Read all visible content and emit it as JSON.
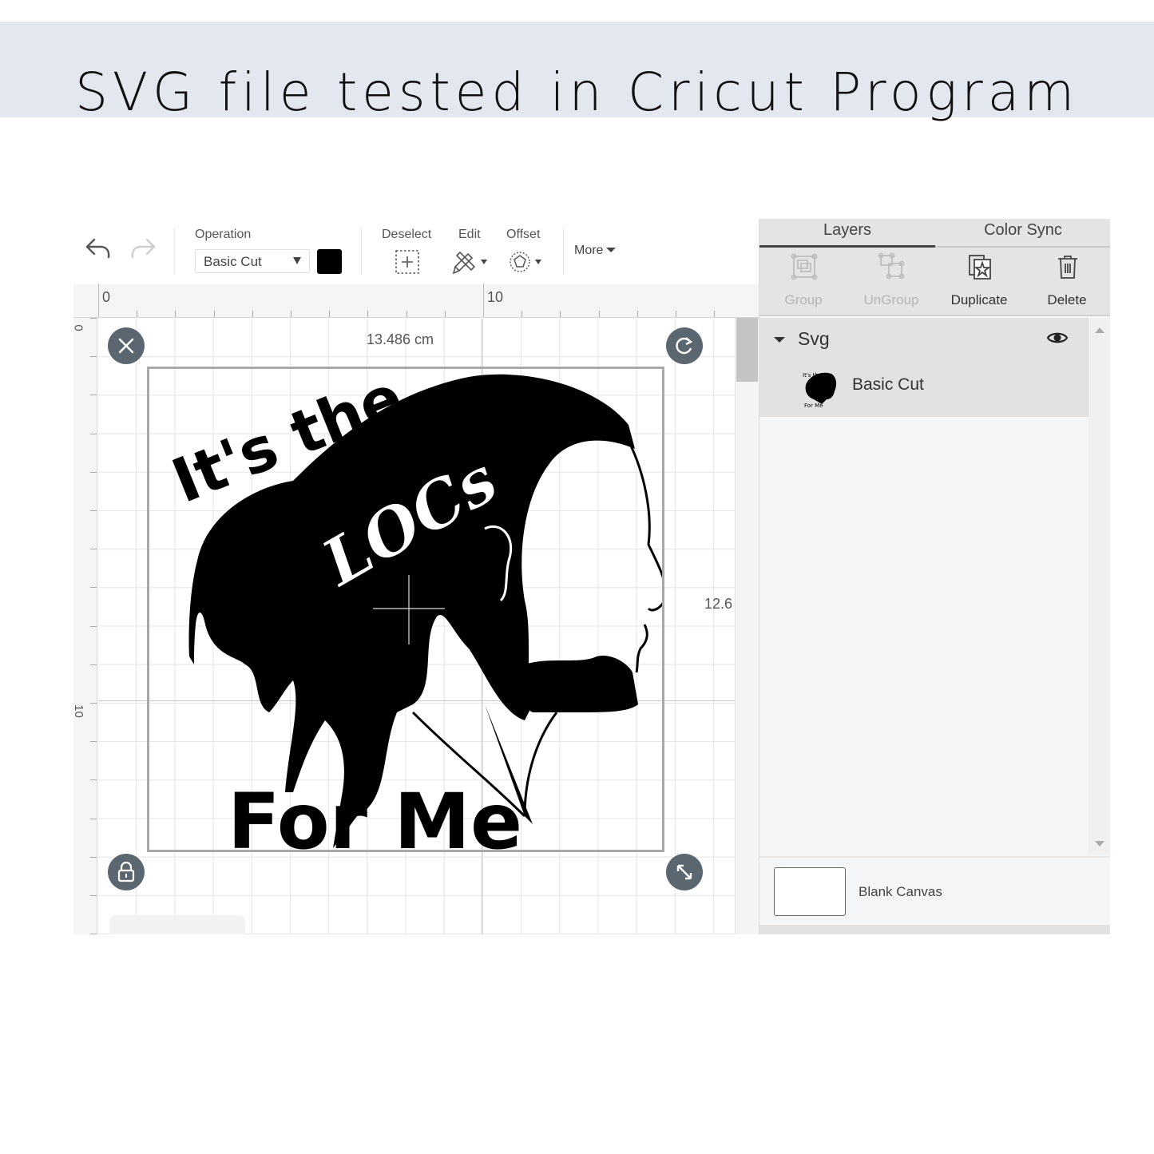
{
  "banner": {
    "title": "SVG file tested in Cricut Program"
  },
  "toolbar": {
    "undo_icon": "undo-icon",
    "redo_icon": "redo-icon",
    "operation_label": "Operation",
    "operation_value": "Basic Cut",
    "operation_color": "#000000",
    "deselect_label": "Deselect",
    "edit_label": "Edit",
    "offset_label": "Offset",
    "more_label": "More"
  },
  "rulers": {
    "top": [
      "0",
      "10"
    ],
    "left": [
      "0",
      "10"
    ]
  },
  "canvas": {
    "width_readout": "13.486 cm",
    "height_readout": "12.6",
    "handles": [
      "close-icon",
      "rotate-icon",
      "lock-icon",
      "resize-icon"
    ],
    "artwork": {
      "text_top": "It's the",
      "text_middle": "LOCs",
      "text_bottom": "For Me"
    }
  },
  "panel": {
    "tabs": [
      {
        "label": "Layers",
        "active": true
      },
      {
        "label": "Color Sync",
        "active": false
      }
    ],
    "actions": [
      {
        "label": "Group",
        "enabled": false,
        "icon": "group-icon"
      },
      {
        "label": "UnGroup",
        "enabled": false,
        "icon": "ungroup-icon"
      },
      {
        "label": "Duplicate",
        "enabled": true,
        "icon": "duplicate-icon"
      },
      {
        "label": "Delete",
        "enabled": true,
        "icon": "trash-icon"
      }
    ],
    "layer_group": {
      "name": "Svg",
      "visible": true
    },
    "layer_item": {
      "name": "Basic Cut"
    },
    "blank_canvas_label": "Blank Canvas"
  }
}
